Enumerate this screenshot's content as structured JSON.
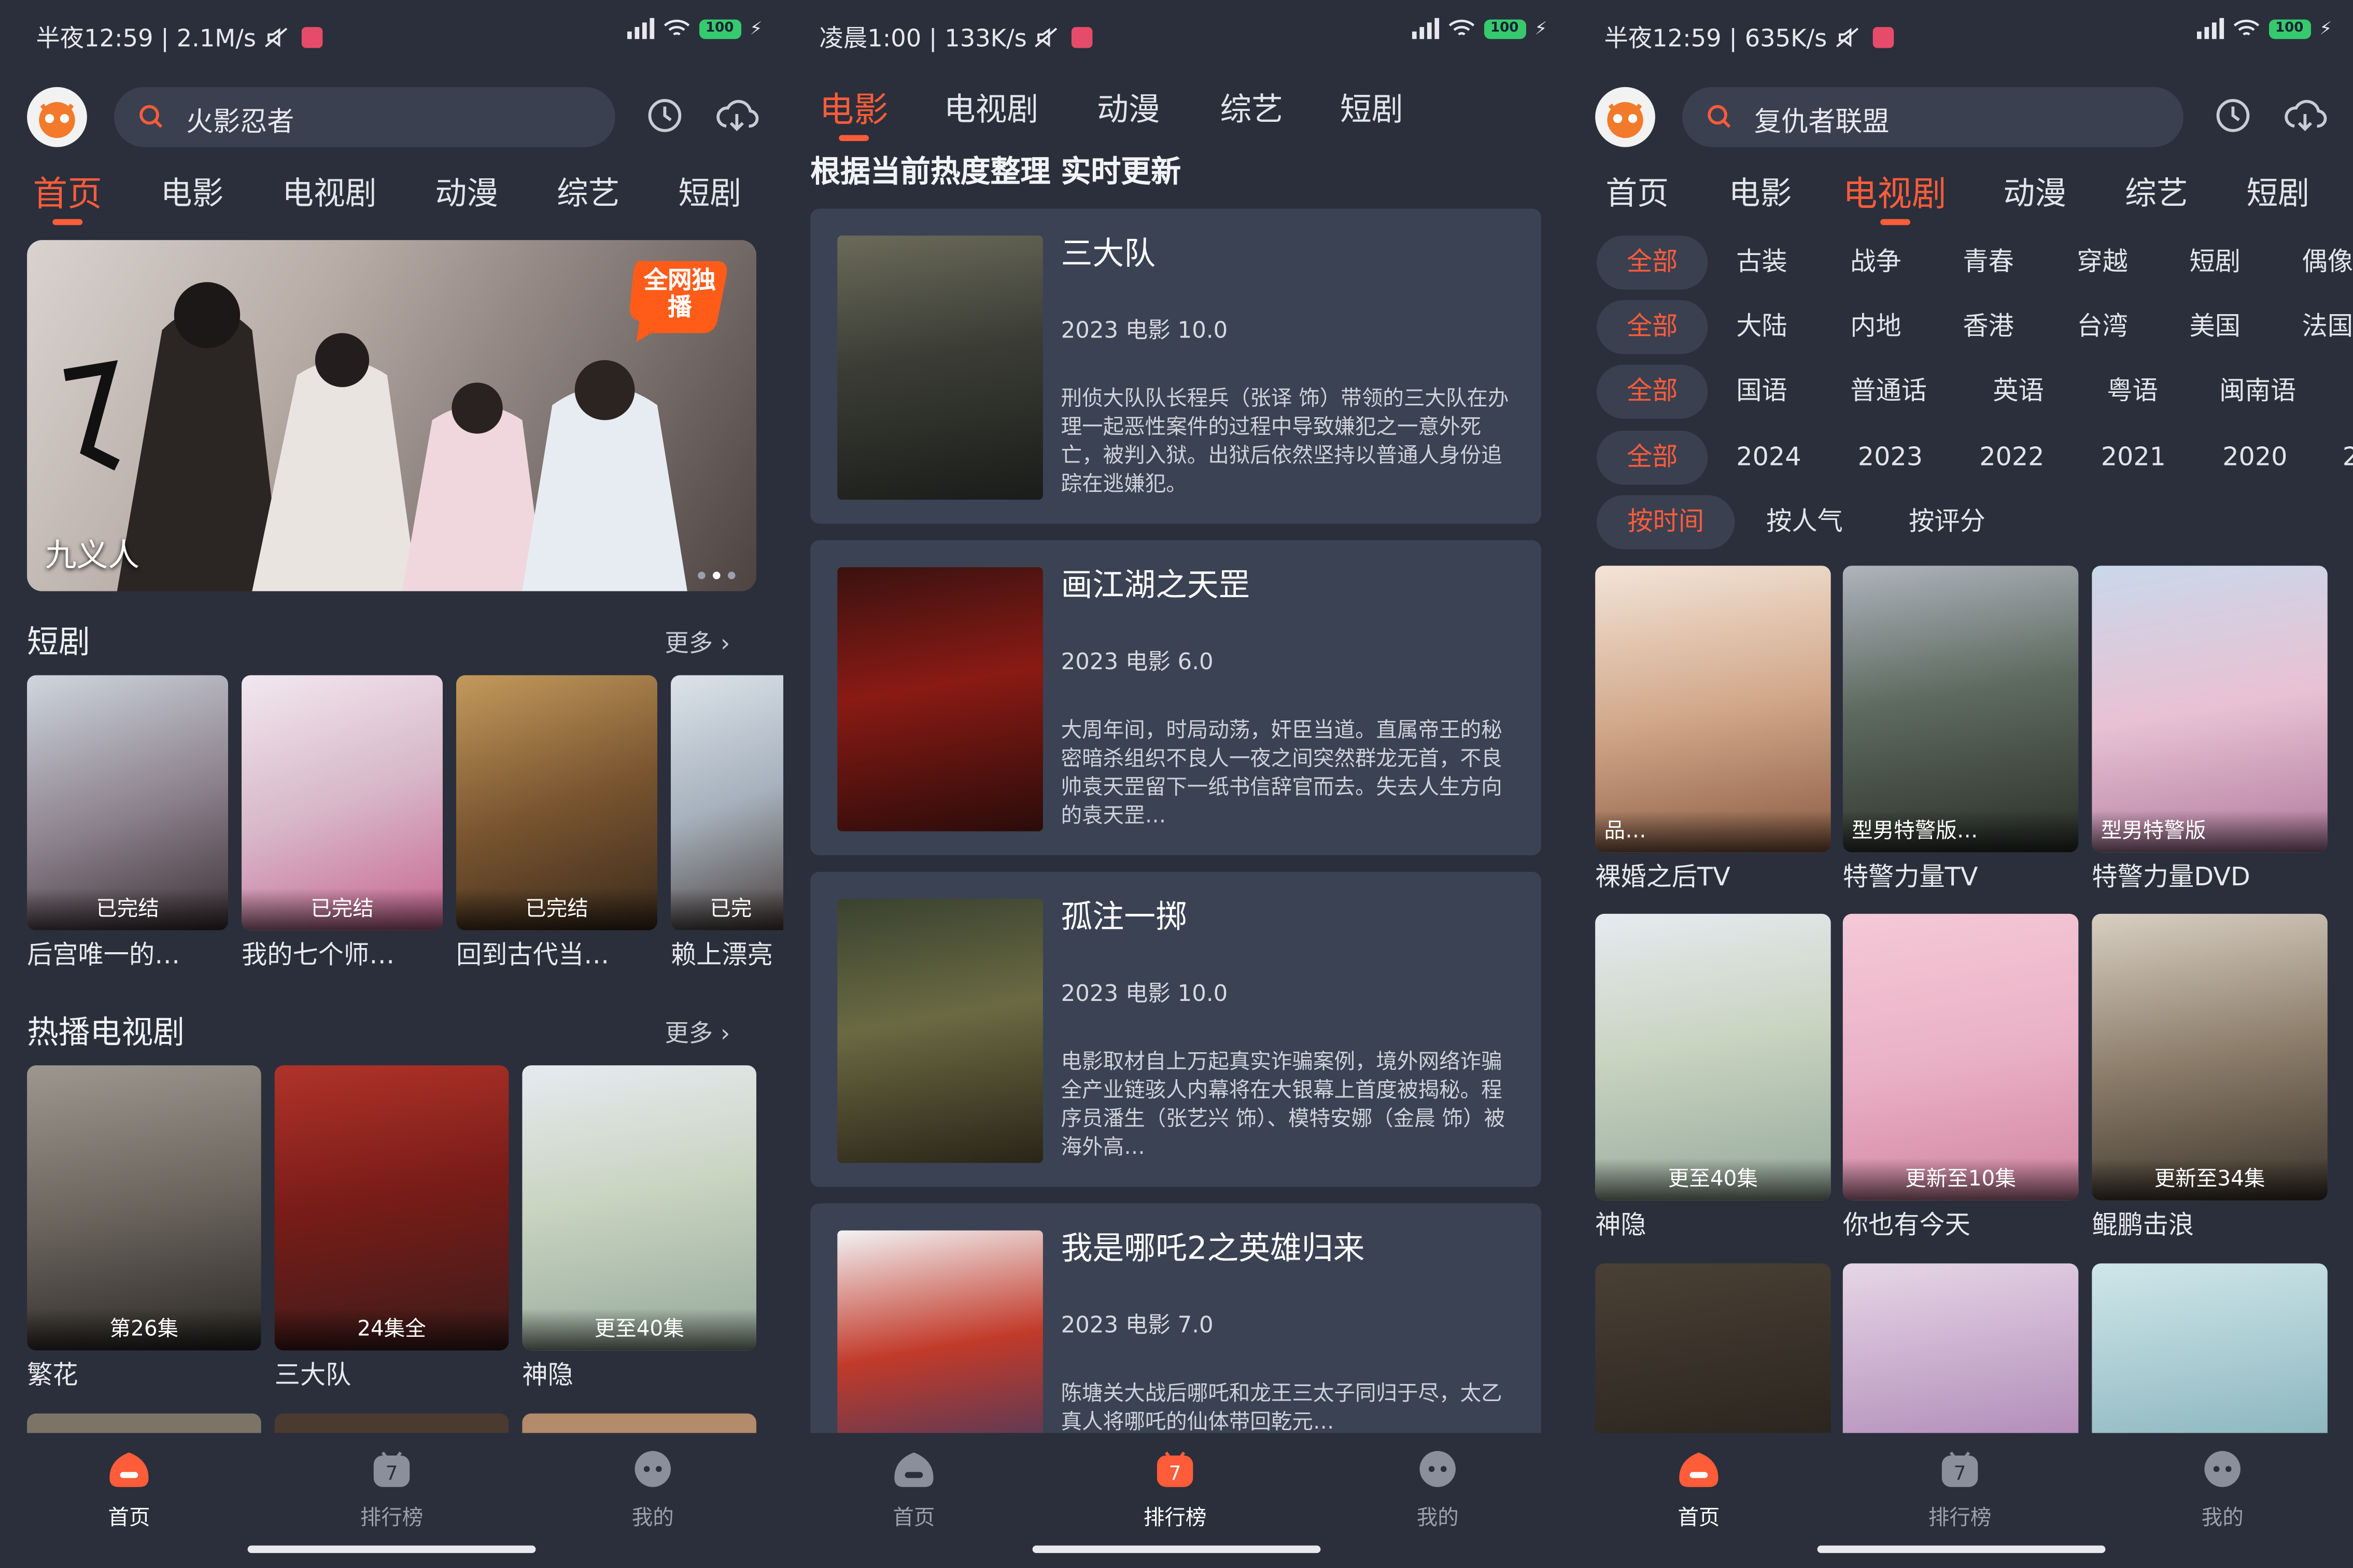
{
  "colors": {
    "accent": "#ff5c3a",
    "background": "#2a2f3b",
    "card": "#3b4253",
    "search": "#3a4050"
  },
  "screens": [
    {
      "status": {
        "time": "半夜12:59 | 2.1M/s",
        "battery": "100"
      },
      "search": {
        "value": "火影忍者"
      },
      "tabs": [
        "首页",
        "电影",
        "电视剧",
        "动漫",
        "综艺",
        "短剧"
      ],
      "banner": {
        "title": "九义人",
        "badge": "全网独播"
      },
      "section1": {
        "title": "短剧",
        "more": "更多"
      },
      "short_dramas": [
        {
          "name": "后宫唯一的…",
          "status": "已完结"
        },
        {
          "name": "我的七个师…",
          "status": "已完结"
        },
        {
          "name": "回到古代当…",
          "status": "已完结"
        },
        {
          "name": "赖上漂亮",
          "status": "已完"
        }
      ],
      "section2": {
        "title": "热播电视剧",
        "more": "更多"
      },
      "hot_tv": [
        {
          "name": "繁花",
          "status": "第26集"
        },
        {
          "name": "三大队",
          "status": "24集全"
        },
        {
          "name": "神隐",
          "status": "更至40集"
        }
      ],
      "nav": [
        "首页",
        "排行榜",
        "我的"
      ]
    },
    {
      "status": {
        "time": "凌晨1:00 | 133K/s",
        "battery": "100"
      },
      "tabs": [
        "电影",
        "电视剧",
        "动漫",
        "综艺",
        "短剧"
      ],
      "subtitle": "根据当前热度整理 实时更新",
      "rankings": [
        {
          "title": "三大队",
          "meta": "2023  电影  10.0",
          "desc": "刑侦大队队长程兵（张译 饰）带领的三大队在办理一起恶性案件的过程中导致嫌犯之一意外死亡，被判入狱。出狱后依然坚持以普通人身份追踪在逃嫌犯。"
        },
        {
          "title": "画江湖之天罡",
          "meta": "2023  电影  6.0",
          "desc": "大周年间，时局动荡，奸臣当道。直属帝王的秘密暗杀组织不良人一夜之间突然群龙无首，不良帅袁天罡留下一纸书信辞官而去。失去人生方向的袁天罡…"
        },
        {
          "title": "孤注一掷",
          "meta": "2023  电影  10.0",
          "desc": "电影取材自上万起真实诈骗案例，境外网络诈骗全产业链骇人内幕将在大银幕上首度被揭秘。程序员潘生（张艺兴 饰）、模特安娜（金晨 饰）被海外高…"
        },
        {
          "title": "我是哪吒2之英雄归来",
          "meta": "2023  电影  7.0",
          "desc": "陈塘关大战后哪吒和龙王三太子同归于尽，太乙真人将哪吒的仙体带回乾元…"
        }
      ],
      "nav": [
        "首页",
        "排行榜",
        "我的"
      ]
    },
    {
      "status": {
        "time": "半夜12:59 | 635K/s",
        "battery": "100"
      },
      "search": {
        "value": "复仇者联盟"
      },
      "tabs": [
        "首页",
        "电影",
        "电视剧",
        "动漫",
        "综艺",
        "短剧"
      ],
      "filters": [
        [
          "全部",
          "古装",
          "战争",
          "青春",
          "穿越",
          "短剧",
          "偶像"
        ],
        [
          "全部",
          "大陆",
          "内地",
          "香港",
          "台湾",
          "美国",
          "法国"
        ],
        [
          "全部",
          "国语",
          "普通话",
          "英语",
          "粤语",
          "闽南语"
        ],
        [
          "全部",
          "2024",
          "2023",
          "2022",
          "2021",
          "2020",
          "2"
        ],
        [
          "按时间",
          "按人气",
          "按评分"
        ]
      ],
      "grid": [
        {
          "name": "裸婚之后TV",
          "status": "品…"
        },
        {
          "name": "特警力量TV",
          "status": "型男特警版…"
        },
        {
          "name": "特警力量DVD",
          "status": "型男特警版"
        },
        {
          "name": "神隐",
          "status": "更至40集"
        },
        {
          "name": "你也有今天",
          "status": "更新至10集"
        },
        {
          "name": "鲲鹏击浪",
          "status": "更新至34集"
        },
        {
          "name": "",
          "status": ""
        },
        {
          "name": "",
          "status": ""
        },
        {
          "name": "",
          "status": ""
        }
      ],
      "nav": [
        "首页",
        "排行榜",
        "我的"
      ]
    }
  ]
}
